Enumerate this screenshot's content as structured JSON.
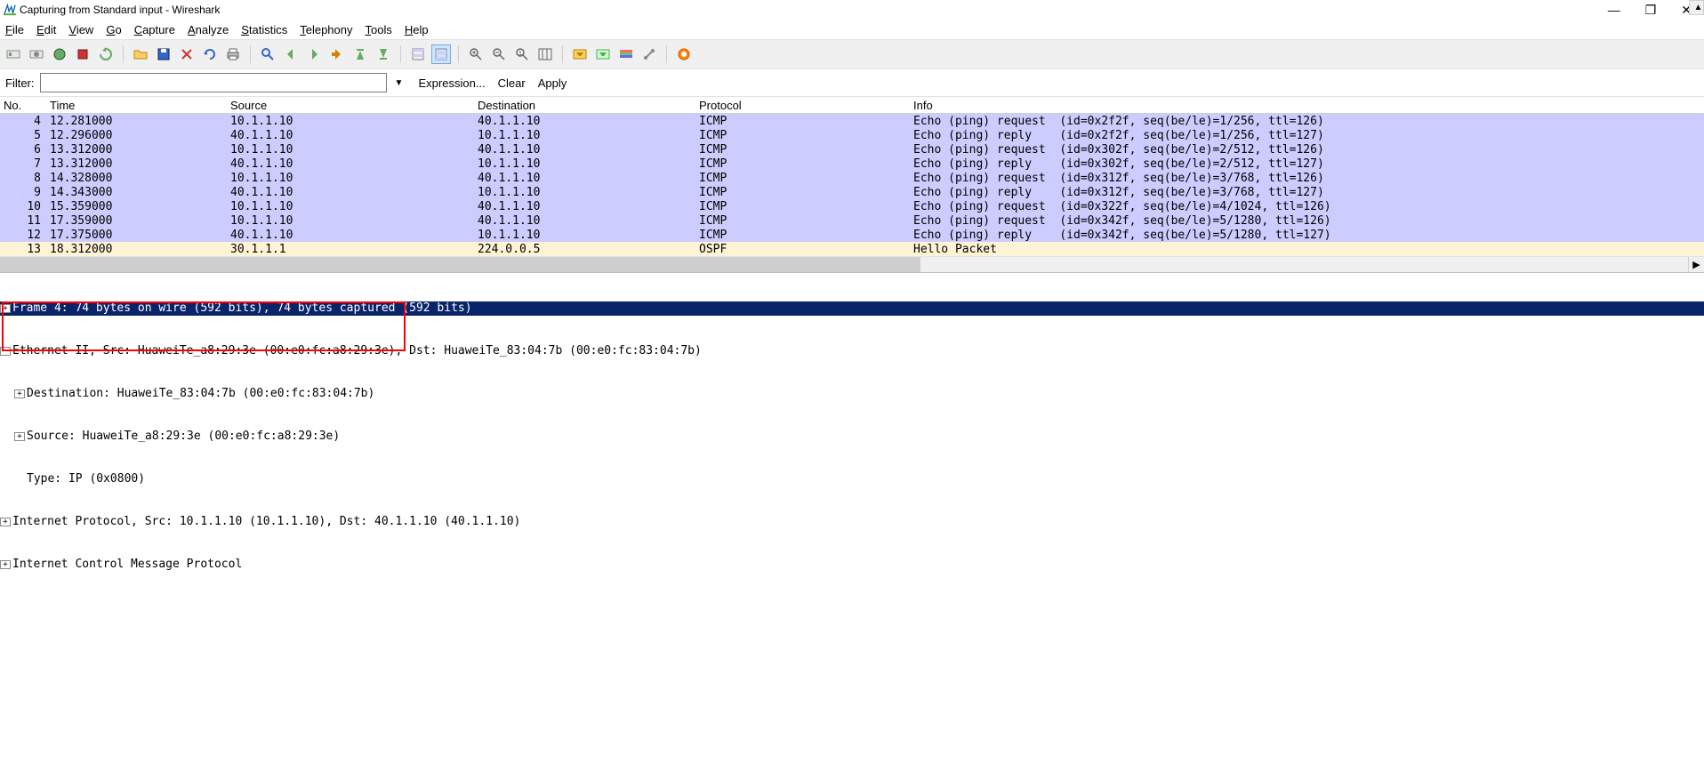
{
  "window": {
    "title": "Capturing from Standard input - Wireshark"
  },
  "menu": {
    "file": "File",
    "edit": "Edit",
    "view": "View",
    "go": "Go",
    "capture": "Capture",
    "analyze": "Analyze",
    "statistics": "Statistics",
    "telephony": "Telephony",
    "tools": "Tools",
    "help": "Help"
  },
  "filter": {
    "label": "Filter:",
    "value": "",
    "expression": "Expression...",
    "clear": "Clear",
    "apply": "Apply"
  },
  "columns": {
    "no": "No.",
    "time": "Time",
    "src": "Source",
    "dst": "Destination",
    "proto": "Protocol",
    "info": "Info"
  },
  "packets": [
    {
      "no": "4",
      "time": "12.281000",
      "src": "10.1.1.10",
      "dst": "40.1.1.10",
      "proto": "ICMP",
      "info": "Echo (ping) request  (id=0x2f2f, seq(be/le)=1/256, ttl=126)",
      "cls": "icmp"
    },
    {
      "no": "5",
      "time": "12.296000",
      "src": "40.1.1.10",
      "dst": "10.1.1.10",
      "proto": "ICMP",
      "info": "Echo (ping) reply    (id=0x2f2f, seq(be/le)=1/256, ttl=127)",
      "cls": "icmp"
    },
    {
      "no": "6",
      "time": "13.312000",
      "src": "10.1.1.10",
      "dst": "40.1.1.10",
      "proto": "ICMP",
      "info": "Echo (ping) request  (id=0x302f, seq(be/le)=2/512, ttl=126)",
      "cls": "icmp"
    },
    {
      "no": "7",
      "time": "13.312000",
      "src": "40.1.1.10",
      "dst": "10.1.1.10",
      "proto": "ICMP",
      "info": "Echo (ping) reply    (id=0x302f, seq(be/le)=2/512, ttl=127)",
      "cls": "icmp"
    },
    {
      "no": "8",
      "time": "14.328000",
      "src": "10.1.1.10",
      "dst": "40.1.1.10",
      "proto": "ICMP",
      "info": "Echo (ping) request  (id=0x312f, seq(be/le)=3/768, ttl=126)",
      "cls": "icmp"
    },
    {
      "no": "9",
      "time": "14.343000",
      "src": "40.1.1.10",
      "dst": "10.1.1.10",
      "proto": "ICMP",
      "info": "Echo (ping) reply    (id=0x312f, seq(be/le)=3/768, ttl=127)",
      "cls": "icmp"
    },
    {
      "no": "10",
      "time": "15.359000",
      "src": "10.1.1.10",
      "dst": "40.1.1.10",
      "proto": "ICMP",
      "info": "Echo (ping) request  (id=0x322f, seq(be/le)=4/1024, ttl=126)",
      "cls": "icmp"
    },
    {
      "no": "11",
      "time": "17.359000",
      "src": "10.1.1.10",
      "dst": "40.1.1.10",
      "proto": "ICMP",
      "info": "Echo (ping) request  (id=0x342f, seq(be/le)=5/1280, ttl=126)",
      "cls": "icmp"
    },
    {
      "no": "12",
      "time": "17.375000",
      "src": "40.1.1.10",
      "dst": "10.1.1.10",
      "proto": "ICMP",
      "info": "Echo (ping) reply    (id=0x342f, seq(be/le)=5/1280, ttl=127)",
      "cls": "icmp"
    },
    {
      "no": "13",
      "time": "18.312000",
      "src": "30.1.1.1",
      "dst": "224.0.0.5",
      "proto": "OSPF",
      "info": "Hello Packet",
      "cls": "ospf"
    }
  ],
  "details": {
    "frame": "Frame 4: 74 bytes on wire (592 bits), 74 bytes captured (592 bits)",
    "eth": "Ethernet II, Src: HuaweiTe_a8:29:3e (00:e0:fc:a8:29:3e), Dst: HuaweiTe_83:04:7b (00:e0:fc:83:04:7b)",
    "eth_dst": "Destination: HuaweiTe_83:04:7b (00:e0:fc:83:04:7b)",
    "eth_src": "Source: HuaweiTe_a8:29:3e (00:e0:fc:a8:29:3e)",
    "eth_type": "Type: IP (0x0800)",
    "ip": "Internet Protocol, Src: 10.1.1.10 (10.1.1.10), Dst: 40.1.1.10 (40.1.1.10)",
    "icmp": "Internet Control Message Protocol"
  }
}
